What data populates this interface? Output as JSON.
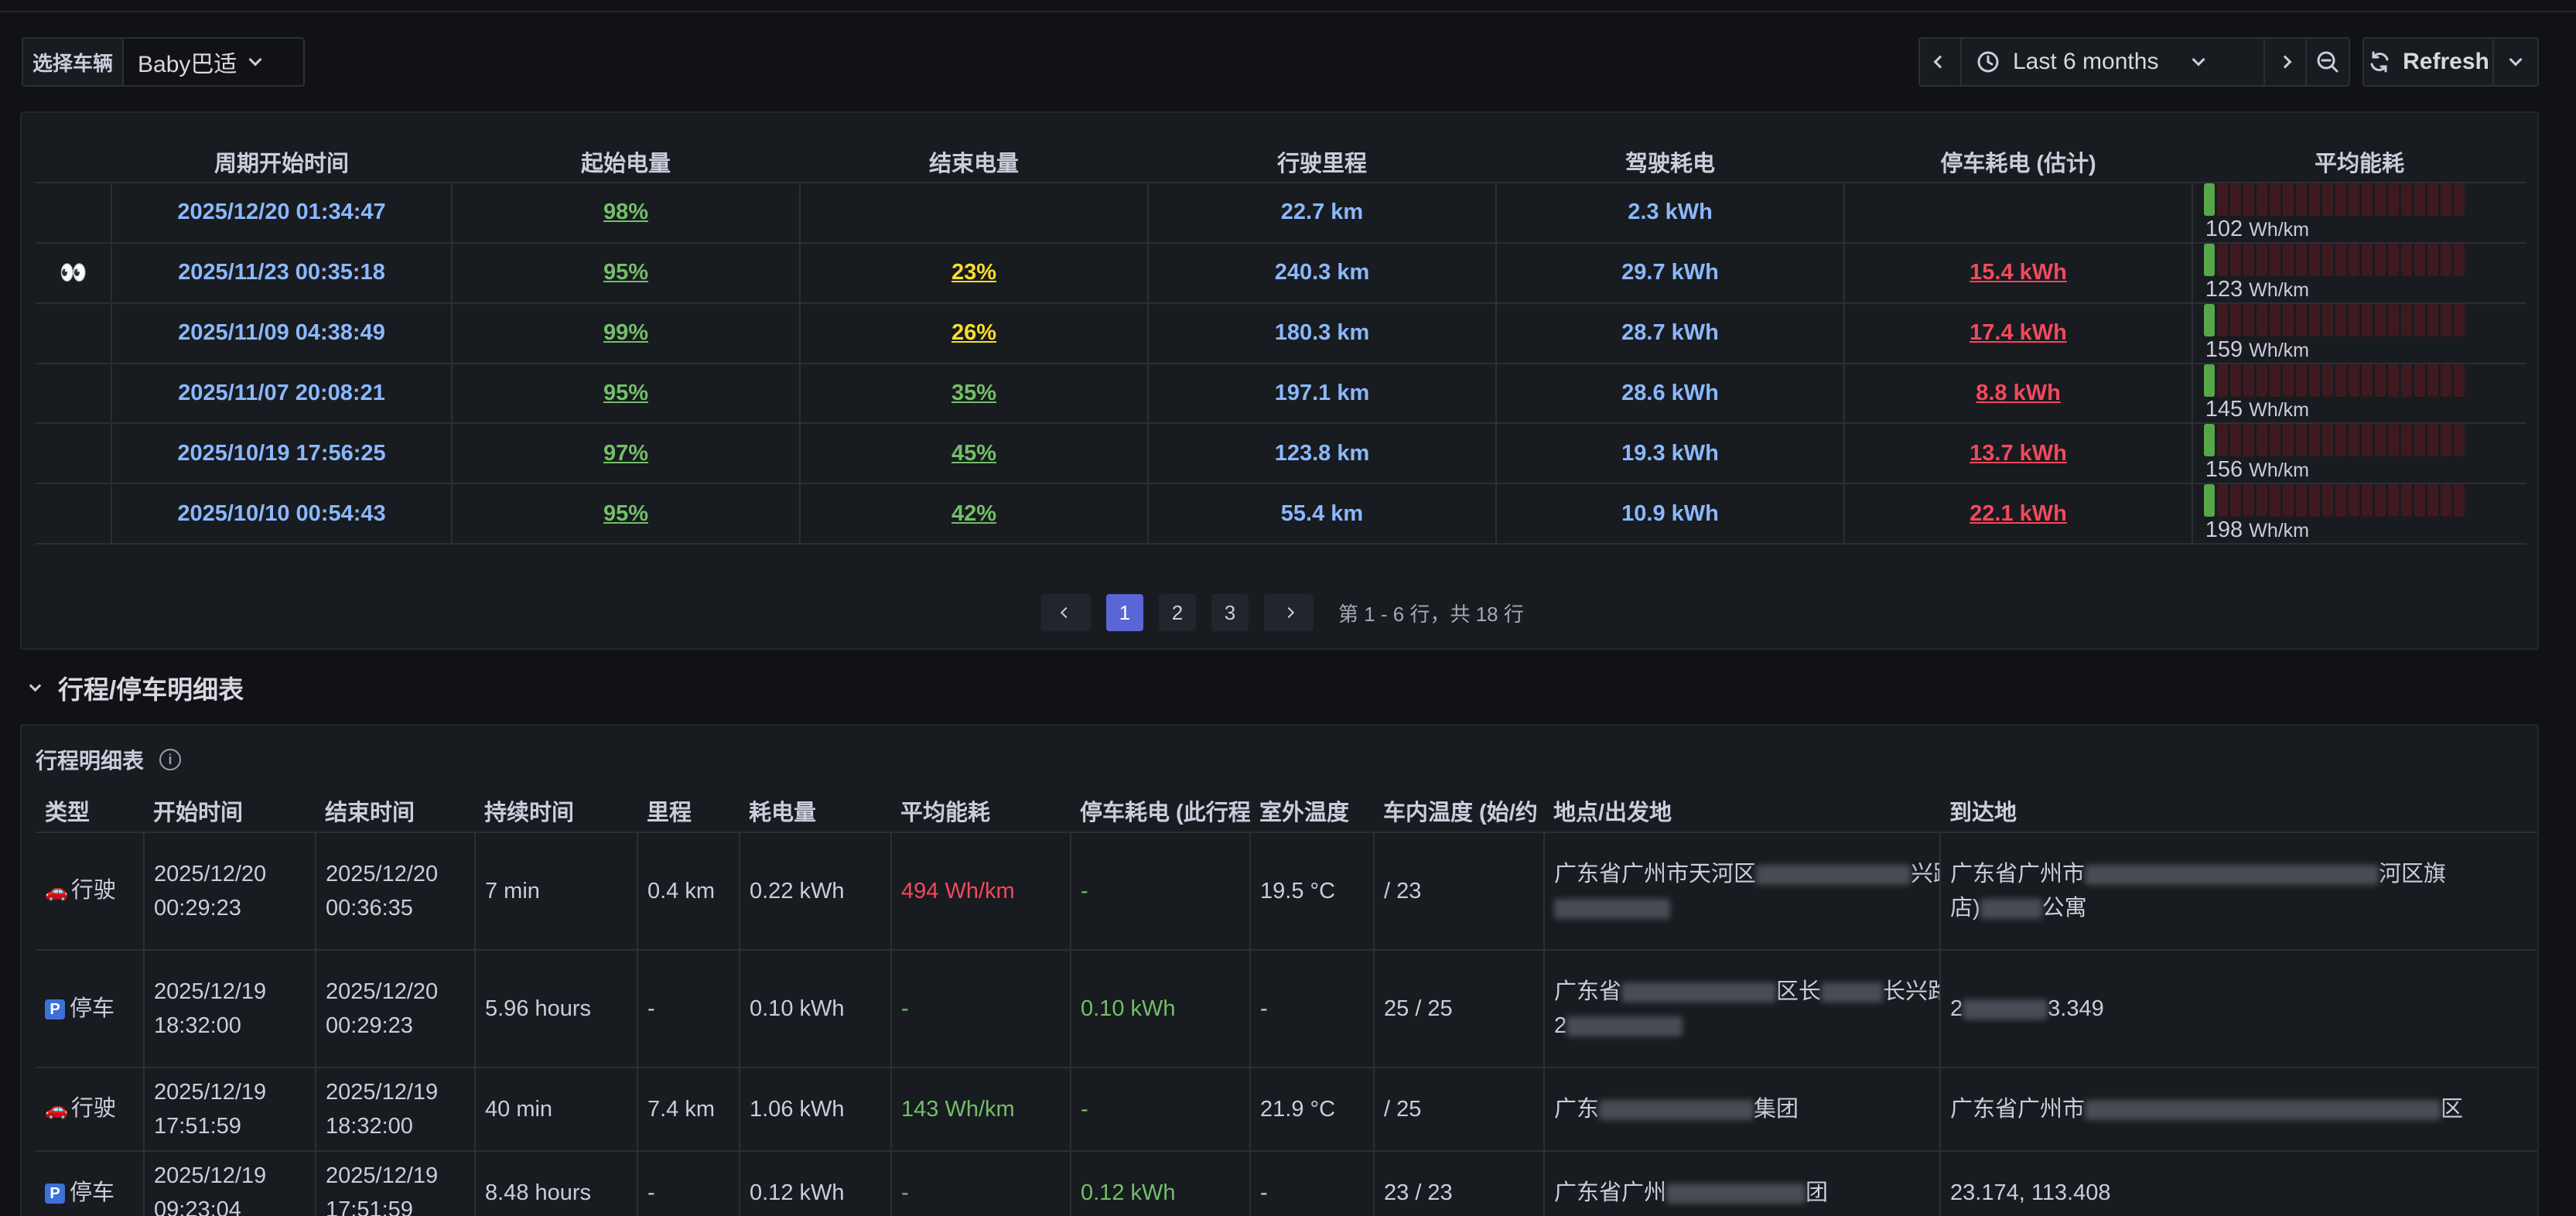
{
  "toolbar": {
    "vehicle_label": "选择车辆",
    "vehicle_value": "Baby巴适",
    "time_range": "Last 6 months",
    "refresh_label": "Refresh"
  },
  "cycle_table": {
    "columns": [
      "周期开始时间",
      "起始电量",
      "结束电量",
      "行驶里程",
      "驾驶耗电",
      "停车耗电 (估计)",
      "平均能耗"
    ],
    "rows": [
      {
        "marker": "",
        "start": "2025/12/20 01:34:47",
        "start_soc": "98%",
        "end_soc": "",
        "end_soc_color": "green",
        "distance": "22.7 km",
        "drive_energy": "2.3 kWh",
        "park_energy": "",
        "avg_value": "102",
        "avg_unit": "Wh/km",
        "avg_level": 0.05
      },
      {
        "marker": "👀",
        "start": "2025/11/23 00:35:18",
        "start_soc": "95%",
        "end_soc": "23%",
        "end_soc_color": "yellow",
        "distance": "240.3 km",
        "drive_energy": "29.7 kWh",
        "park_energy": "15.4 kWh",
        "avg_value": "123",
        "avg_unit": "Wh/km",
        "avg_level": 0.05
      },
      {
        "marker": "",
        "start": "2025/11/09 04:38:49",
        "start_soc": "99%",
        "end_soc": "26%",
        "end_soc_color": "yellow",
        "distance": "180.3 km",
        "drive_energy": "28.7 kWh",
        "park_energy": "17.4 kWh",
        "avg_value": "159",
        "avg_unit": "Wh/km",
        "avg_level": 0.05
      },
      {
        "marker": "",
        "start": "2025/11/07 20:08:21",
        "start_soc": "95%",
        "end_soc": "35%",
        "end_soc_color": "green",
        "distance": "197.1 km",
        "drive_energy": "28.6 kWh",
        "park_energy": "8.8 kWh",
        "avg_value": "145",
        "avg_unit": "Wh/km",
        "avg_level": 0.05
      },
      {
        "marker": "",
        "start": "2025/10/19 17:56:25",
        "start_soc": "97%",
        "end_soc": "45%",
        "end_soc_color": "green",
        "distance": "123.8 km",
        "drive_energy": "19.3 kWh",
        "park_energy": "13.7 kWh",
        "avg_value": "156",
        "avg_unit": "Wh/km",
        "avg_level": 0.05
      },
      {
        "marker": "",
        "start": "2025/10/10 00:54:43",
        "start_soc": "95%",
        "end_soc": "42%",
        "end_soc_color": "green",
        "distance": "55.4 km",
        "drive_energy": "10.9 kWh",
        "park_energy": "22.1 kWh",
        "avg_value": "198",
        "avg_unit": "Wh/km",
        "avg_level": 0.05
      }
    ],
    "pagination": {
      "pages": [
        "1",
        "2",
        "3"
      ],
      "current": "1",
      "info": "第 1 - 6 行，共 18 行"
    }
  },
  "row_section": {
    "title": "行程/停车明细表"
  },
  "trip_table": {
    "title": "行程明细表",
    "columns": [
      "类型",
      "开始时间",
      "结束时间",
      "持续时间",
      "里程",
      "耗电量",
      "平均能耗",
      "停车耗电 (此行程",
      "室外温度",
      "车内温度 (始/约",
      "地点/出发地",
      "到达地"
    ],
    "rows": [
      {
        "icon": "car-icon",
        "type": "行驶",
        "start": "2025/12/20",
        "start_time": "00:29:23",
        "end": "2025/12/20",
        "end_time": "00:36:35",
        "duration": "7 min",
        "distance": "0.4 km",
        "energy": "0.22 kWh",
        "avg": "494 Wh/km",
        "avg_color": "red",
        "park": "-",
        "park_color": "yellow",
        "outside": "19.5 °C",
        "inside": "/ 23",
        "from1": "广东省广州市天河区",
        "from1b": "兴路",
        "from2": "",
        "to1": "广东省广州市",
        "to1b": "河区旗",
        "to2": "店)",
        "to2b": "公寓"
      },
      {
        "icon": "parking-icon",
        "type": "停车",
        "start": "2025/12/19",
        "start_time": "18:32:00",
        "end": "2025/12/20",
        "end_time": "00:29:23",
        "duration": "5.96 hours",
        "distance": "-",
        "energy": "0.10 kWh",
        "avg": "-",
        "avg_color": "green",
        "park": "0.10 kWh",
        "park_color": "green",
        "outside": "-",
        "inside": "25 / 25",
        "from1": "广东省",
        "from1b": "区长",
        "from1c": "长兴路",
        "from2": "2",
        "to1": "2",
        "to1b": "3.349",
        "to2": "",
        "to2b": ""
      },
      {
        "icon": "car-icon",
        "type": "行驶",
        "start": "2025/12/19",
        "start_time": "17:51:59",
        "end": "2025/12/19",
        "end_time": "18:32:00",
        "duration": "40 min",
        "distance": "7.4 km",
        "energy": "1.06 kWh",
        "avg": "143 Wh/km",
        "avg_color": "green",
        "park": "-",
        "park_color": "yellow",
        "outside": "21.9 °C",
        "inside": "/ 25",
        "from1": "广东",
        "from1b": "集团",
        "from2": "",
        "to1": "广东省广州市",
        "to1b": "区",
        "to2": "",
        "to2b": ""
      },
      {
        "icon": "parking-icon",
        "type": "停车",
        "start": "2025/12/19",
        "start_time": "09:23:04",
        "end": "2025/12/19",
        "end_time": "17:51:59",
        "duration": "8.48 hours",
        "distance": "-",
        "energy": "0.12 kWh",
        "avg": "-",
        "avg_color": "green",
        "park": "0.12 kWh",
        "park_color": "green",
        "outside": "-",
        "inside": "23 / 23",
        "from1": "广东省广州",
        "from1b": "团",
        "from2": "",
        "to1": "23.174, 113.408",
        "to1b": "",
        "to2": "",
        "to2b": ""
      }
    ]
  },
  "colors": {
    "background": "#111217",
    "panel": "#181b1f",
    "green": "#73bf69",
    "yellow": "#fade2a",
    "red": "#f2495c",
    "blue": "#83a8ff",
    "accent": "#5b66d6"
  }
}
